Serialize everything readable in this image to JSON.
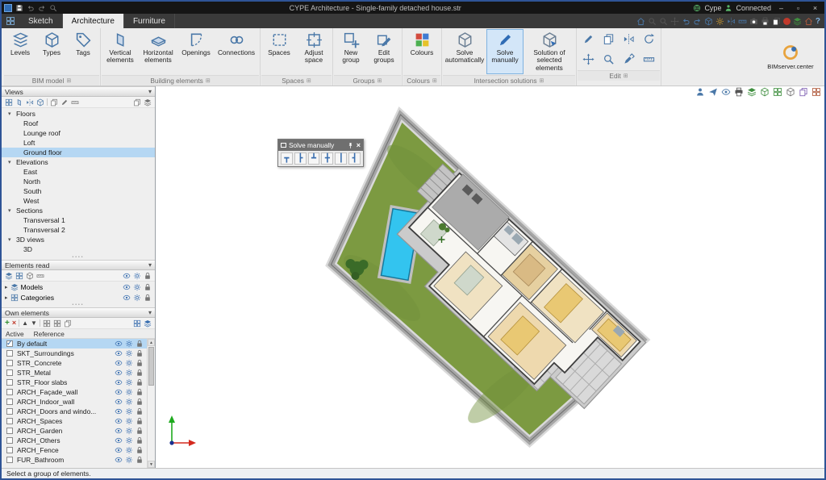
{
  "window": {
    "title": "CYPE Architecture - Single-family detached house.str",
    "brand": "Cype",
    "connection": "Connected",
    "titlebar_icons": [
      "app-icon",
      "save-icon",
      "undo-icon",
      "redo-icon",
      "zoom-icon"
    ],
    "controls": [
      "minimize",
      "maximize",
      "close"
    ]
  },
  "tabs": [
    {
      "label": "Sketch",
      "active": false
    },
    {
      "label": "Architecture",
      "active": true
    },
    {
      "label": "Furniture",
      "active": false
    }
  ],
  "quick_access_icons": [
    "favourites",
    "search",
    "zoom-window",
    "zoom-all",
    "pan",
    "previous-view",
    "next-view",
    "3d-view",
    "settings-sun",
    "section",
    "measure",
    "camera",
    "print",
    "screenshot",
    "record",
    "layers",
    "bim-model",
    "help"
  ],
  "ribbon": {
    "groups": [
      {
        "name": "BIM model",
        "buttons": [
          {
            "label": "Levels"
          },
          {
            "label": "Types"
          },
          {
            "label": "Tags"
          }
        ]
      },
      {
        "name": "Building elements",
        "buttons": [
          {
            "label": "Vertical elements"
          },
          {
            "label": "Horizontal elements"
          },
          {
            "label": "Openings"
          },
          {
            "label": "Connections"
          }
        ]
      },
      {
        "name": "Spaces",
        "buttons": [
          {
            "label": "Spaces"
          },
          {
            "label": "Adjust space"
          }
        ]
      },
      {
        "name": "Groups",
        "buttons": [
          {
            "label": "New group"
          },
          {
            "label": "Edit groups"
          }
        ]
      },
      {
        "name": "Colours",
        "buttons": [
          {
            "label": "Colours"
          }
        ]
      },
      {
        "name": "Intersection solutions",
        "buttons": [
          {
            "label": "Solve automatically"
          },
          {
            "label": "Solve manually",
            "active": true
          },
          {
            "label": "Solution of selected elements"
          }
        ]
      },
      {
        "name": "Edit",
        "icons": [
          "edit",
          "move",
          "copy",
          "mirror",
          "rotate",
          "zoom",
          "match-properties",
          "measure"
        ]
      }
    ],
    "bimserver_label": "BIMserver.center"
  },
  "sidebar": {
    "views": {
      "title": "Views",
      "toolbar_icons": [
        "plan-view",
        "elevation-view",
        "section-view",
        "3d-view",
        "duplicate-view",
        "edit-view",
        "measure-view",
        "copy-view",
        "layers-view"
      ],
      "tree": [
        {
          "label": "Floors",
          "level": 0,
          "expanded": true
        },
        {
          "label": "Roof",
          "level": 1
        },
        {
          "label": "Lounge roof",
          "level": 1
        },
        {
          "label": "Loft",
          "level": 1
        },
        {
          "label": "Ground floor",
          "level": 1,
          "selected": true
        },
        {
          "label": "Elevations",
          "level": 0,
          "expanded": true
        },
        {
          "label": "East",
          "level": 1
        },
        {
          "label": "North",
          "level": 1
        },
        {
          "label": "South",
          "level": 1
        },
        {
          "label": "West",
          "level": 1
        },
        {
          "label": "Sections",
          "level": 0,
          "expanded": true
        },
        {
          "label": "Transversal 1",
          "level": 1
        },
        {
          "label": "Transversal 2",
          "level": 1
        },
        {
          "label": "3D views",
          "level": 0,
          "expanded": true
        },
        {
          "label": "3D",
          "level": 1
        }
      ]
    },
    "elements_read": {
      "title": "Elements read",
      "toolbar_icons": [
        "expand-all",
        "collapse-all",
        "select-all",
        "filter"
      ],
      "rows": [
        {
          "label": "Models"
        },
        {
          "label": "Categories"
        }
      ]
    },
    "own_elements": {
      "title": "Own elements",
      "toolbar_icons": [
        "add",
        "delete",
        "move-up",
        "move-down",
        "group",
        "ungroup",
        "copy",
        "highlight",
        "isolate"
      ],
      "columns": [
        "Active",
        "Reference"
      ],
      "rows": [
        {
          "label": "By default",
          "checked": true,
          "selected": true
        },
        {
          "label": "SKT_Surroundings",
          "checked": false
        },
        {
          "label": "STR_Concrete",
          "checked": false
        },
        {
          "label": "STR_Metal",
          "checked": false
        },
        {
          "label": "STR_Floor slabs",
          "checked": false
        },
        {
          "label": "ARCH_Façade_wall",
          "checked": false
        },
        {
          "label": "ARCH_Indoor_wall",
          "checked": false
        },
        {
          "label": "ARCH_Doors and windo...",
          "checked": false
        },
        {
          "label": "ARCH_Spaces",
          "checked": false
        },
        {
          "label": "ARCH_Garden",
          "checked": false
        },
        {
          "label": "ARCH_Others",
          "checked": false
        },
        {
          "label": "ARCH_Fence",
          "checked": false
        },
        {
          "label": "FUR_Bathroom",
          "checked": false
        }
      ]
    }
  },
  "canvas": {
    "toolbar_icons": [
      "walkthrough",
      "publish",
      "visibility",
      "print",
      "export",
      "model-3d",
      "layers",
      "components",
      "materials",
      "textures"
    ],
    "floating_toolbar": {
      "title": "Solve manually",
      "options": [
        "joint-t",
        "joint-l",
        "joint-bottom",
        "joint-cross",
        "joint-straight",
        "joint-r"
      ]
    }
  },
  "statusbar": {
    "message": "Select a group of elements."
  }
}
